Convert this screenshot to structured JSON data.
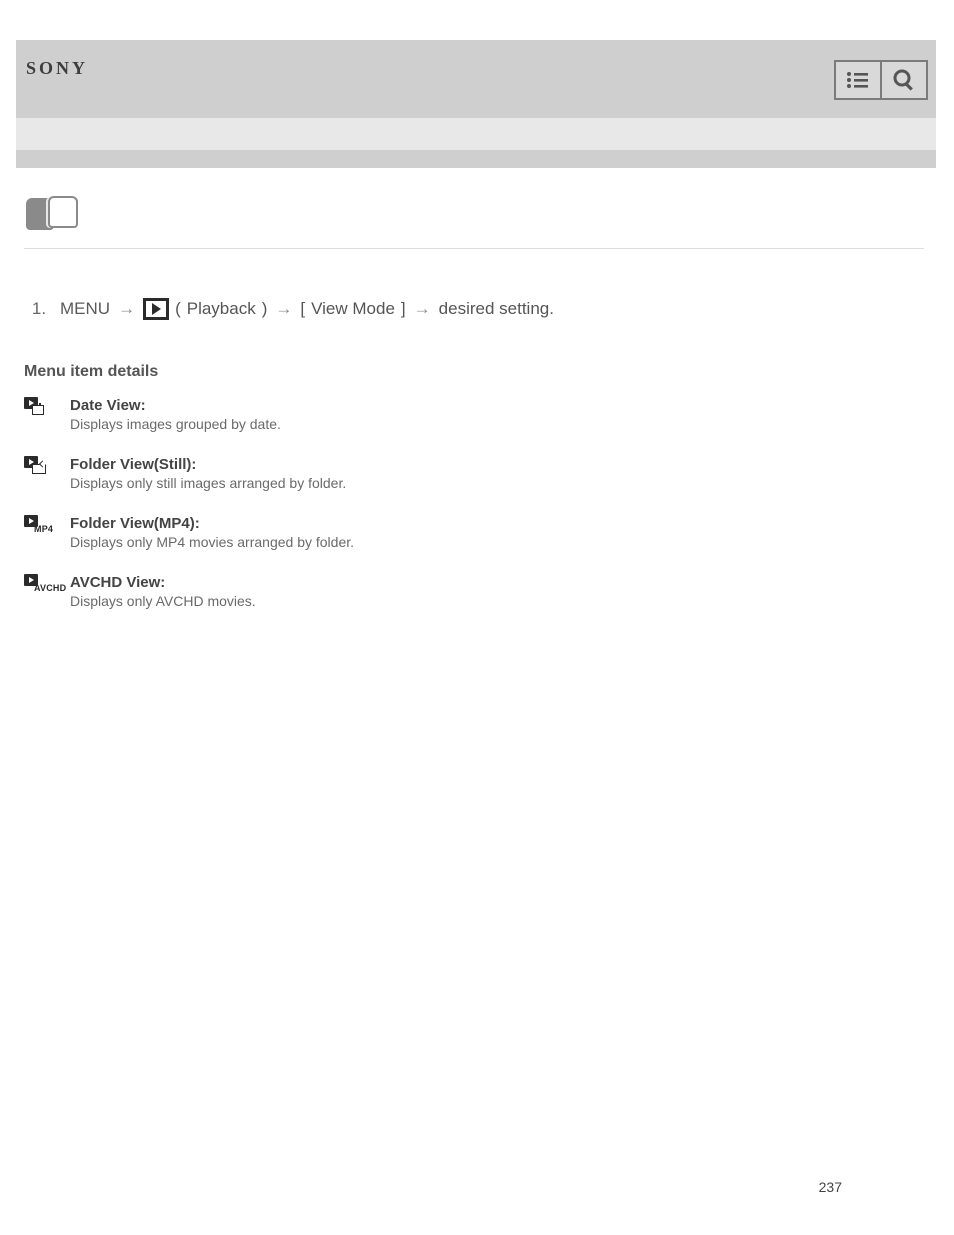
{
  "brand": "SONY",
  "step": {
    "menu": "MENU",
    "playback_label": "Playback",
    "view_mode_label": "View Mode",
    "close_paren": ")",
    "desired_setting_prefix": "desired setting."
  },
  "section_title": "Menu item details",
  "options": [
    {
      "key": "date",
      "label": "Date View:",
      "desc": "Displays images grouped by date."
    },
    {
      "key": "folder",
      "label": "Folder View(Still):",
      "desc": "Displays only still images arranged by folder."
    },
    {
      "key": "mp4",
      "label": "Folder View(MP4):",
      "desc": "Displays only MP4 movies arranged by folder."
    },
    {
      "key": "avchd",
      "label": "AVCHD View:",
      "desc": "Displays only AVCHD movies."
    }
  ],
  "icon_tags": {
    "mp4": "MP4",
    "avchd": "AVCHD"
  },
  "arrow_glyph": "→",
  "page_number": "237"
}
